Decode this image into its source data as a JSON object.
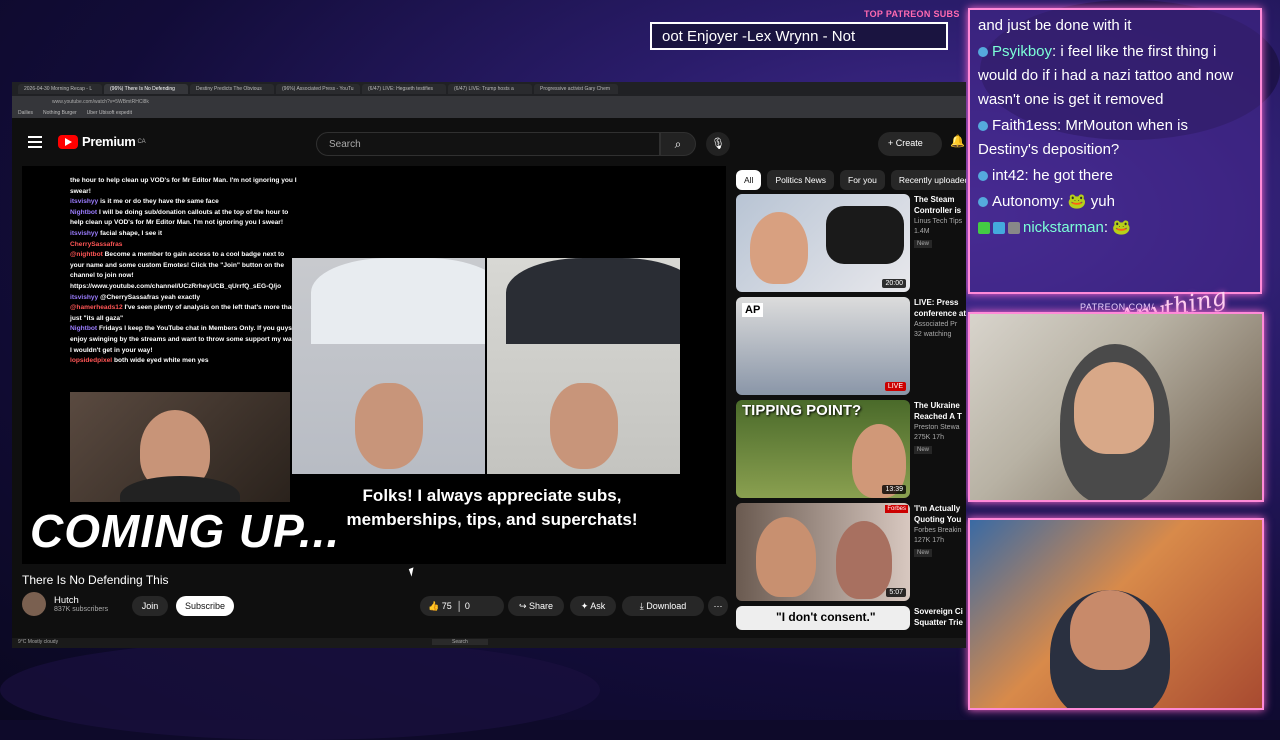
{
  "overlay": {
    "top_patreon_label": "TOP PATREON SUBS",
    "ticker_text": "oot Enjoyer -Lex Wrynn -  Not",
    "patreon_url": "PATREON.COM/",
    "script_logo": "Anything Else"
  },
  "chat": {
    "messages": [
      {
        "user": "",
        "text": "and just be done with it"
      },
      {
        "user": "Psyikboy",
        "text": "i feel like the first thing i would do if i had a nazi tattoo and now wasn't one is get it removed"
      },
      {
        "user": "Faith1ess",
        "text": "MrMouton when is Destiny's deposition?"
      },
      {
        "user": "int42",
        "text": "he got there"
      },
      {
        "user": "Autonomy",
        "text": "yuh"
      },
      {
        "user": "nickstarman",
        "text": ""
      }
    ]
  },
  "browser": {
    "tabs": [
      "2026-04-30 Morning Recap - L",
      "(96%) There Is No Defending",
      "Destiny Predicts The Obvious",
      "(96%) Associated Press - YouTu",
      "(6/47) LIVE: Hegseth testifies",
      "(6/47) LIVE: Trump hosts a",
      "Progressive activist Gary Chem"
    ],
    "address": "www.youtube.com/watch?v=5WBmtRHCl8k",
    "bookmarks": [
      "Dailies",
      "Nothing Burger",
      "Uber Ubisoft expedit"
    ]
  },
  "youtube": {
    "brand": "Premium",
    "region": "CA",
    "search_placeholder": "Search",
    "create_label": "Create",
    "video": {
      "title": "There Is No Defending This",
      "channel": "Hutch",
      "subscribers": "837K subscribers",
      "join": "Join",
      "subscribe": "Subscribe",
      "likes": "75",
      "dislikes": "0",
      "share": "Share",
      "ask": "Ask",
      "download": "Download",
      "overlay_folks_1": "Folks! I always appreciate subs,",
      "overlay_folks_2": "memberships, tips, and superchats!",
      "coming_up": "COMING UP...",
      "embedded_chat": [
        {
          "u": "",
          "t": "the hour to help clean up VOD's for Mr Editor Man. I'm not ignoring you I swear!"
        },
        {
          "u": "itsvishyy",
          "t": "is it me or do they have the same face"
        },
        {
          "u": "Nightbot",
          "t": "I will be doing sub/donation callouts at the top of the hour to help clean up VOD's for Mr Editor Man. I'm not ignoring you I swear!"
        },
        {
          "u": "itsvishyy",
          "t": "facial shape, I see it"
        },
        {
          "u": "CherrySassafras",
          "t": ""
        },
        {
          "u": "@nightbot",
          "t": "Become a member to gain access to a cool badge next to your name and some custom Emotes! Click the \"Join\" button on the channel to join now! https://www.youtube.com/channel/UCzRrheyUCB_qUrrfQ_sEG-Q/jo"
        },
        {
          "u": "itsvishyy",
          "t": "@CherrySassafras yeah exactly"
        },
        {
          "u": "@hamerheads12",
          "t": "I've seen plenty of analysis on the left that's more than just \"its all gaza\""
        },
        {
          "u": "Nightbot",
          "t": "Fridays I keep the YouTube chat in Members Only. If you guys enjoy swinging by the streams and want to throw some support my way, I wouldn't get in your way!"
        },
        {
          "u": "lopsidedpixel",
          "t": "both wide eyed white men yes"
        }
      ]
    },
    "chips": [
      "All",
      "Politics News",
      "For you",
      "Recently uploaded"
    ],
    "recommendations": [
      {
        "title": "The Steam Controller is Here",
        "channel": "Linus Tech Tips",
        "meta": "1.4M",
        "badge": "New",
        "duration": "20:00",
        "live": false
      },
      {
        "title": "LIVE: Press conference at Miami airp",
        "channel": "Associated Pr",
        "meta": "32 watching",
        "badge": "",
        "duration": "LIVE",
        "live": true
      },
      {
        "title": "The Ukraine Reached A T",
        "channel": "Preston Stewa",
        "meta": "275K  17h",
        "badge": "New",
        "duration": "13:39",
        "live": false
      },
      {
        "title": "'I'm Actually Quoting You Directly, Mr.",
        "channel": "Forbes Breakin",
        "meta": "127K  17h",
        "badge": "New",
        "duration": "5:07",
        "live": false
      },
      {
        "title": "Sovereign Ci Squatter Trie",
        "channel": "",
        "meta": "",
        "badge": "",
        "duration": "",
        "live": false
      }
    ],
    "thumb_text": {
      "tipping": "TIPPING POINT?",
      "consent": "\"I don't consent.\"",
      "ap": "AP",
      "forbes": "Forbes"
    }
  },
  "taskbar": {
    "search": "Search",
    "weather": "9°C Mostly cloudy"
  },
  "colors": {
    "accent": "#ff0000",
    "chat_user": "#7cffd8",
    "frame": "#ff8ad8"
  }
}
